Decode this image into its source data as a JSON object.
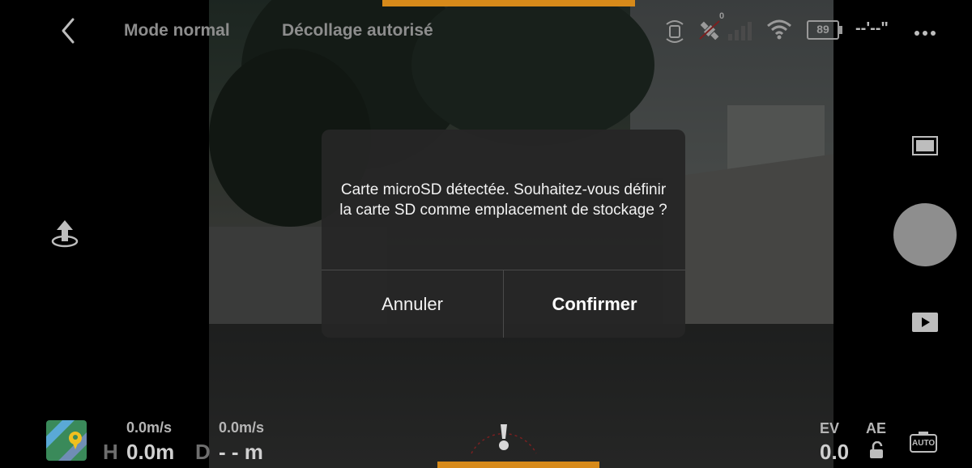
{
  "topbar": {
    "flight_mode": "Mode normal",
    "takeoff_status": "Décollage autorisé",
    "satellite_count": "0",
    "battery_percent": "89",
    "flight_time": "--'--\"",
    "icons": [
      "back-icon",
      "obstacle-sensing-icon",
      "satellite-icon",
      "signal-bars-icon",
      "wifi-icon",
      "battery-icon",
      "more-icon"
    ]
  },
  "dialog": {
    "message": "Carte microSD détectée. Souhaitez-vous définir la carte SD comme emplacement de stockage ?",
    "cancel_label": "Annuler",
    "confirm_label": "Confirmer"
  },
  "left_panel": {
    "icons": [
      "takeoff-icon",
      "map-icon"
    ]
  },
  "right_panel": {
    "icons": [
      "aspect-ratio-icon",
      "shutter-button",
      "playback-icon",
      "camera-settings-icon"
    ],
    "camera_mode_label": "AUTO"
  },
  "telemetry": {
    "horizontal_speed": "0.0m/s",
    "vertical_speed": "0.0m/s",
    "height_label": "H",
    "height_value": "0.0m",
    "distance_label": "D",
    "distance_value": "- - m",
    "ev_label": "EV",
    "ev_value": "0.0",
    "ae_label": "AE"
  },
  "colors": {
    "accent_orange": "#d78a1a",
    "dialog_bg": "#262626",
    "map_green": "#3a8a5a"
  }
}
